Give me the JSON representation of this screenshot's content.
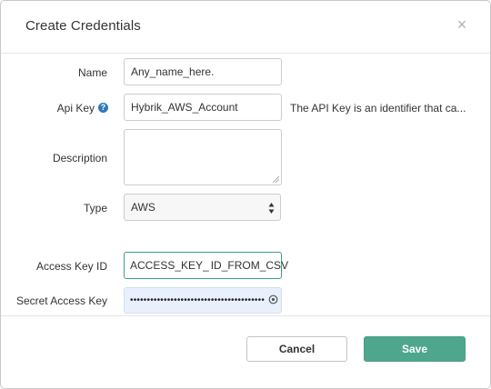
{
  "dialog": {
    "title": "Create Credentials",
    "close_symbol": "×"
  },
  "form": {
    "name": {
      "label": "Name",
      "value": "Any_name_here."
    },
    "api_key": {
      "label": "Api Key",
      "help_icon": "question-circle-icon",
      "value": "Hybrik_AWS_Account",
      "hint": "The API Key is an identifier that ca..."
    },
    "description": {
      "label": "Description",
      "value": ""
    },
    "type": {
      "label": "Type",
      "selected": "AWS"
    },
    "access_key_id": {
      "label": "Access Key ID",
      "value_before_cursor": "ACCESS_KEY_",
      "value_after_cursor": "ID_FROM_CSV"
    },
    "secret_access_key": {
      "label": "Secret Access Key",
      "masked_value": "••••••••••••••••••••••••••••••••••••••••",
      "icon": "key-reveal-icon"
    }
  },
  "footer": {
    "cancel_label": "Cancel",
    "save_label": "Save"
  },
  "colors": {
    "save_button": "#4ea78d",
    "focus_border": "#3c9f86",
    "autofill_bg": "#e8f0fe",
    "help_icon": "#2f79b9"
  }
}
